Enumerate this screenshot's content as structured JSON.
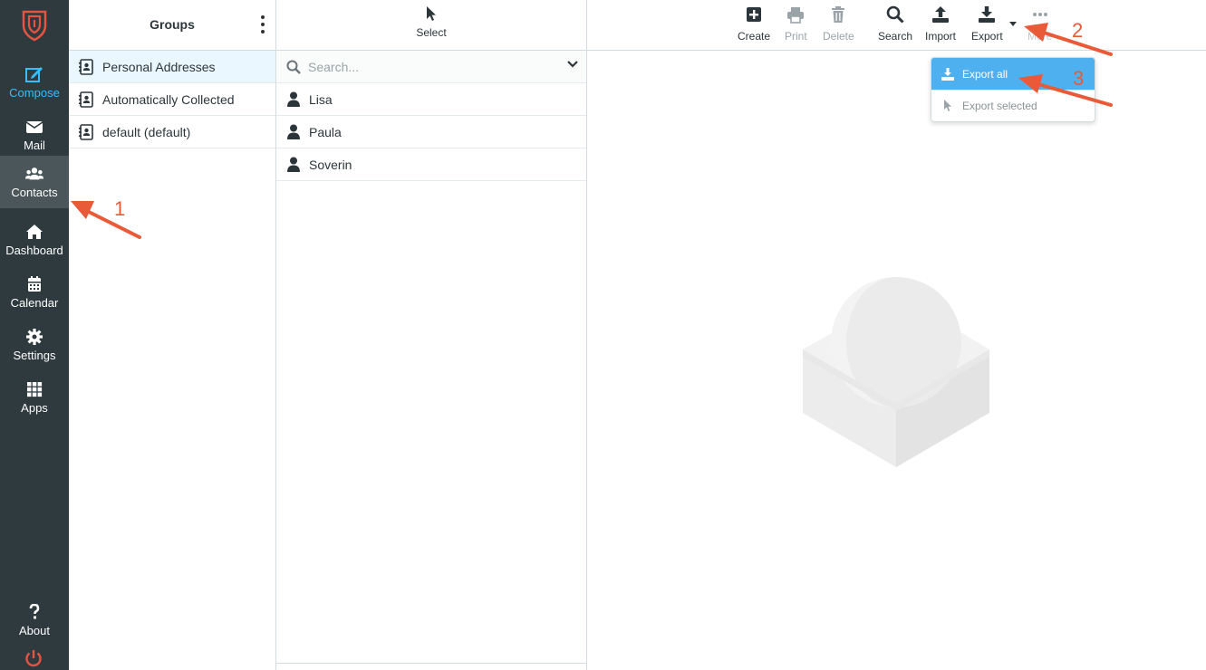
{
  "nav": {
    "items": [
      {
        "label": "Compose",
        "icon": "compose-icon"
      },
      {
        "label": "Mail",
        "icon": "mail-icon"
      },
      {
        "label": "Contacts",
        "icon": "contacts-icon"
      },
      {
        "label": "Dashboard",
        "icon": "home-icon"
      },
      {
        "label": "Calendar",
        "icon": "calendar-icon"
      },
      {
        "label": "Settings",
        "icon": "gear-icon"
      },
      {
        "label": "Apps",
        "icon": "apps-grid-icon"
      },
      {
        "label": "About",
        "icon": "question-icon"
      }
    ],
    "active": "Contacts",
    "accent_color": "#37beff",
    "brand_color": "#e55441"
  },
  "groups": {
    "title": "Groups",
    "items": [
      {
        "label": "Personal Addresses"
      },
      {
        "label": "Automatically Collected"
      },
      {
        "label": "default (default)"
      }
    ]
  },
  "contact_list": {
    "select_label": "Select",
    "search_placeholder": "Search...",
    "contacts": [
      {
        "name": "Lisa"
      },
      {
        "name": "Paula"
      },
      {
        "name": "Soverin"
      }
    ]
  },
  "toolbar": {
    "create": "Create",
    "print": "Print",
    "delete": "Delete",
    "search": "Search",
    "import": "Import",
    "export": "Export",
    "more": "More"
  },
  "export_menu": {
    "export_all": "Export all",
    "export_selected": "Export selected",
    "highlight_color": "#4fb0ef"
  },
  "annotations": {
    "color": "#e85a38",
    "labels": [
      "1",
      "2",
      "3"
    ]
  }
}
